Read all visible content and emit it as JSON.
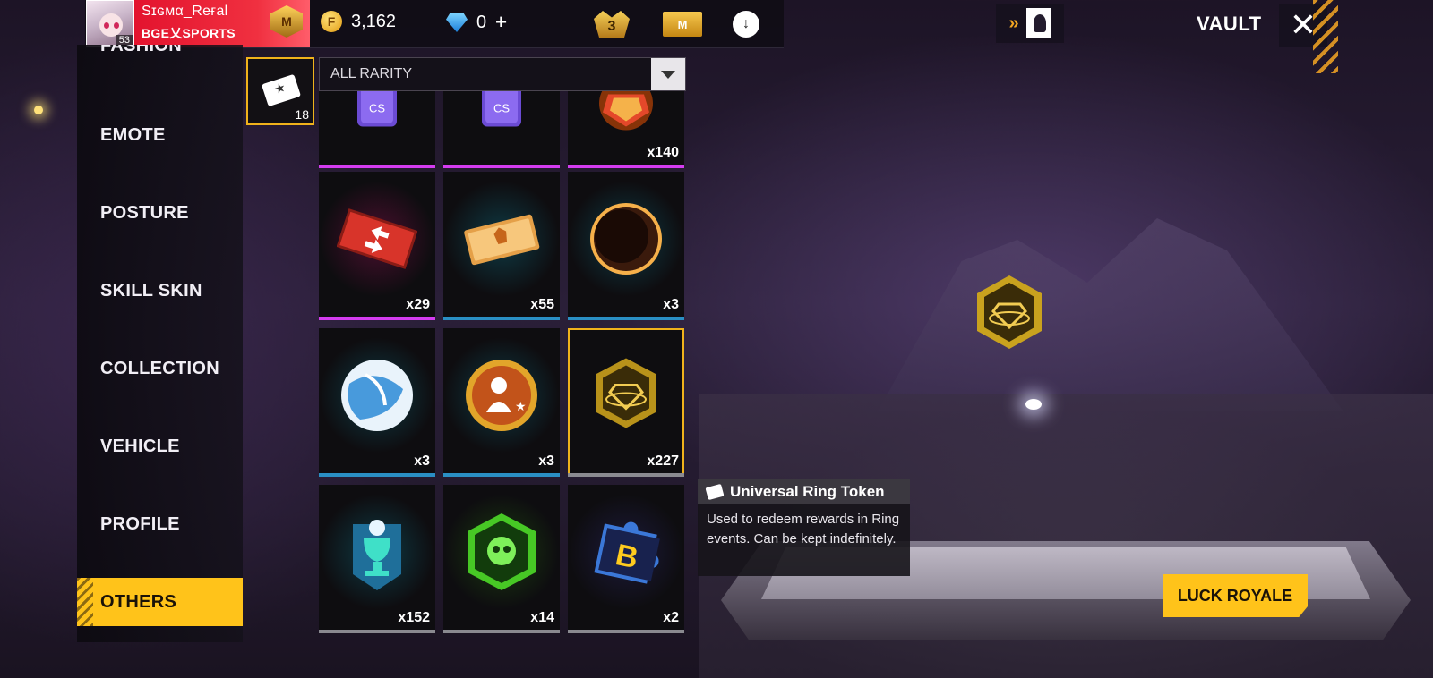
{
  "header": {
    "player": {
      "name": "Sɪɢмα_Reғal",
      "guild": "BGE乂SPORTS",
      "level": "53"
    },
    "gold": {
      "icon": "gold-coin-icon",
      "symbol": "F",
      "value": "3,162"
    },
    "diamonds": {
      "icon": "diamond-icon",
      "value": "0",
      "plus": "+"
    },
    "elite_pass_level": "3",
    "membership_letter": "M",
    "vault_title": "VAULT",
    "close_symbol": "✕",
    "bag_chevron": "»",
    "cloud_symbol": "↓"
  },
  "sidebar": {
    "items": [
      {
        "label": "FASHION"
      },
      {
        "label": "EMOTE"
      },
      {
        "label": "POSTURE"
      },
      {
        "label": "SKILL SKIN"
      },
      {
        "label": "COLLECTION"
      },
      {
        "label": "VEHICLE"
      },
      {
        "label": "PROFILE"
      },
      {
        "label": "OTHERS",
        "active": true
      }
    ]
  },
  "category": {
    "icon": "ticket-icon",
    "count": "18"
  },
  "filter": {
    "label": "ALL RARITY"
  },
  "items": [
    {
      "name": "cs-card-1",
      "qty": "",
      "rarity_color": "#d43cf0",
      "glyph": "CS"
    },
    {
      "name": "cs-card-2",
      "qty": "",
      "rarity_color": "#d43cf0",
      "glyph": "CS"
    },
    {
      "name": "fire-token",
      "qty": "x140",
      "rarity_color": "#d43cf0"
    },
    {
      "name": "swap-voucher",
      "qty": "x29",
      "rarity_color": "#d43cf0"
    },
    {
      "name": "gold-voucher",
      "qty": "x55",
      "rarity_color": "#2a8fc4"
    },
    {
      "name": "eclipse-orb",
      "qty": "x3",
      "rarity_color": "#2a8fc4"
    },
    {
      "name": "football",
      "qty": "x3",
      "rarity_color": "#2a8fc4"
    },
    {
      "name": "character-token",
      "qty": "x3",
      "rarity_color": "#2a8fc4"
    },
    {
      "name": "universal-ring-token",
      "qty": "x227",
      "rarity_color": "#8a8a90",
      "selected": true
    },
    {
      "name": "trophy-token",
      "qty": "x152",
      "rarity_color": "#8a8a90"
    },
    {
      "name": "skull-token",
      "qty": "x14",
      "rarity_color": "#8a8a90"
    },
    {
      "name": "booyah-puzzle",
      "qty": "x2",
      "rarity_color": "#8a8a90",
      "glyph": "B"
    }
  ],
  "tooltip": {
    "title": "Universal Ring Token",
    "description": "Used to redeem rewards in Ring events. Can be kept indefinitely."
  },
  "luck_royale": {
    "label": "LUCK ROYALE"
  }
}
